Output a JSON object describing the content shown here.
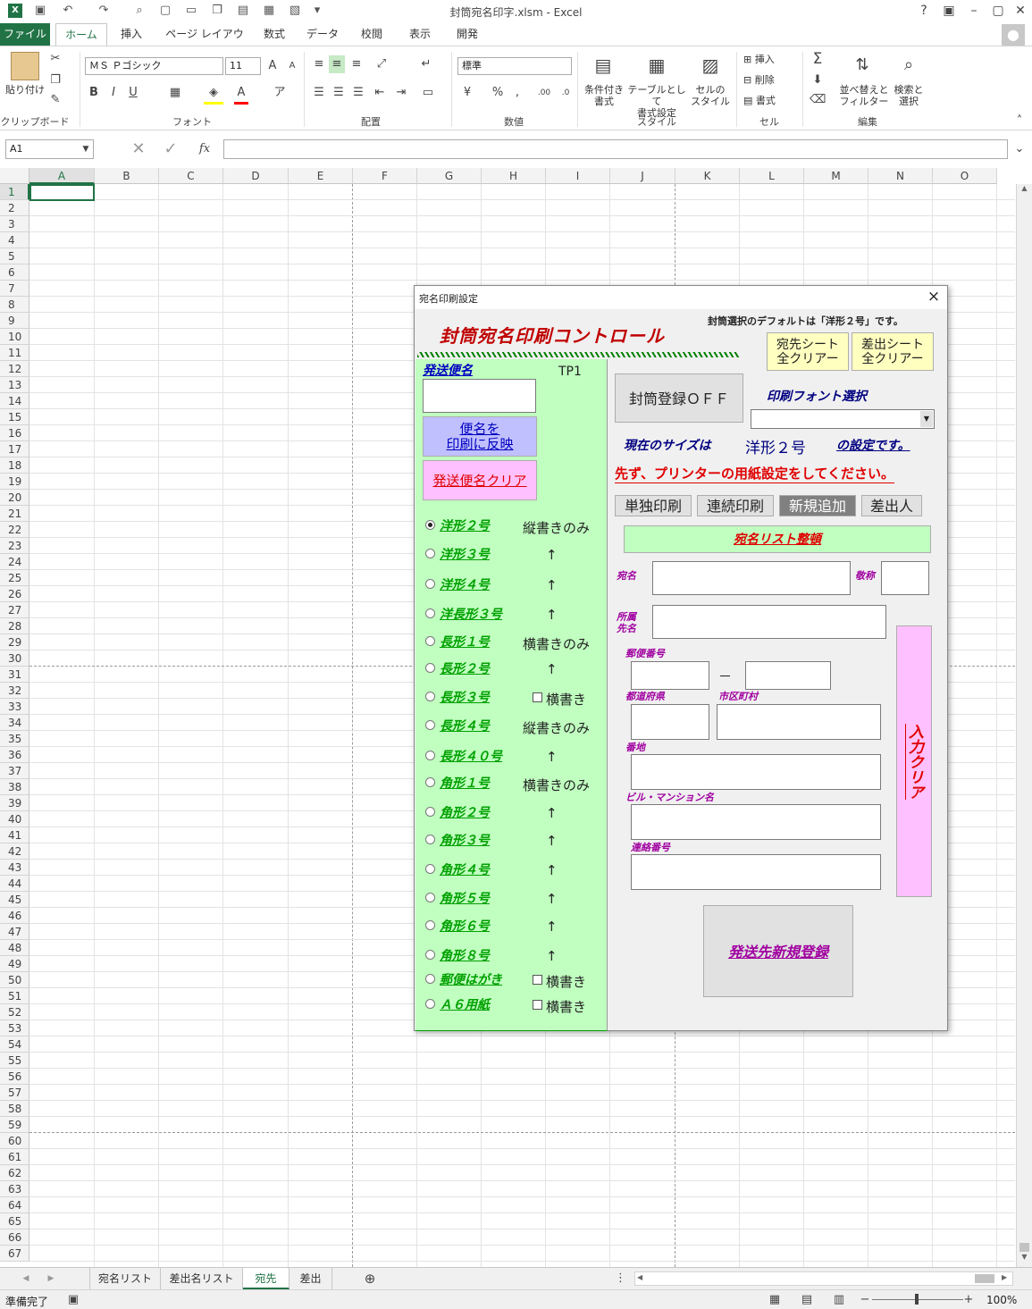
{
  "window": {
    "title": "封筒宛名印字.xlsm - Excel"
  },
  "tabs": [
    "ファイル",
    "ホーム",
    "挿入",
    "ページ レイアウト",
    "数式",
    "データ",
    "校閲",
    "表示",
    "開発"
  ],
  "ribbon": {
    "clipboard": {
      "paste": "貼り付け",
      "label": "クリップボード"
    },
    "font": {
      "name": "ＭＳ Ｐゴシック",
      "size": "11",
      "label": "フォント",
      "bold": "B",
      "italic": "I",
      "underline": "U"
    },
    "alignment": {
      "label": "配置"
    },
    "number": {
      "format": "標準",
      "label": "数値",
      "percent": "%"
    },
    "styles": {
      "conditional": [
        "条件付き",
        "書式"
      ],
      "table": [
        "テーブルとして",
        "書式設定"
      ],
      "cell": [
        "セルの",
        "スタイル"
      ],
      "label": "スタイル"
    },
    "cells": {
      "insert": "挿入",
      "delete": "削除",
      "format": "書式",
      "label": "セル"
    },
    "editing": {
      "sort": [
        "並べ替えと",
        "フィルター"
      ],
      "find": [
        "検索と",
        "選択"
      ],
      "label": "編集"
    }
  },
  "formula_bar": {
    "name_box": "A1",
    "fx": "fx",
    "value": ""
  },
  "grid": {
    "columns": [
      "A",
      "B",
      "C",
      "D",
      "E",
      "F",
      "G",
      "H",
      "I",
      "J",
      "K",
      "L",
      "M",
      "N",
      "O"
    ],
    "rows": [
      "1",
      "2",
      "3",
      "4",
      "5",
      "6",
      "7",
      "8",
      "9",
      "10",
      "11",
      "12",
      "13",
      "14",
      "15",
      "16",
      "17",
      "18",
      "19",
      "20",
      "21",
      "22",
      "23",
      "24",
      "25",
      "26",
      "27",
      "28",
      "29",
      "30",
      "31",
      "32",
      "33",
      "34",
      "35",
      "36",
      "37",
      "38",
      "39",
      "40",
      "41",
      "42",
      "43",
      "44",
      "45",
      "46",
      "47",
      "48",
      "49",
      "50",
      "51",
      "52",
      "53",
      "54",
      "55",
      "56",
      "57",
      "58",
      "59",
      "60",
      "61",
      "62",
      "63",
      "64",
      "65",
      "66",
      "67"
    ]
  },
  "sheet_tabs": [
    "宛名リスト",
    "差出名リスト",
    "宛先",
    "差出"
  ],
  "status": {
    "ready": "準備完了",
    "zoom": "100%"
  },
  "dialog": {
    "title": "宛名印刷設定",
    "close": "×",
    "header": "封筒宛名印刷コントロール",
    "default_note": "封筒選択のデフォルトは「洋形２号」です。",
    "btn_dest_clear": [
      "宛先シート",
      "全クリアー"
    ],
    "btn_sender_clear": [
      "差出シート",
      "全クリアー"
    ],
    "shipping_label": "発送便名",
    "tp": "TP1",
    "btn_reflect": [
      "便名を",
      "印刷に反映"
    ],
    "btn_ship_clear": "発送便名クリア",
    "btn_env_register": "封筒登録ＯＦＦ",
    "font_select_label": "印刷フォント選択",
    "size_label": "現在のサイズは",
    "size_value": "洋形２号",
    "size_suffix": "の設定です。",
    "printer_note": "先ず、プリンターの用紙設定をしてください。",
    "btn_single": "単独印刷",
    "btn_continuous": "連続印刷",
    "btn_new": "新規追加",
    "btn_sender": "差出人",
    "btn_list": "宛名リスト整頓",
    "lbl_name": "宛名",
    "lbl_honor": "敬称",
    "lbl_org": [
      "所属",
      "先名"
    ],
    "lbl_zip": "郵便番号",
    "zip_dash": "－",
    "lbl_pref": "都道府県",
    "lbl_city": "市区町村",
    "lbl_addr": "番地",
    "lbl_bldg": "ビル・マンション名",
    "lbl_tel": "連絡番号",
    "btn_input_clear": "入力クリア",
    "btn_register": "発送先新規登録",
    "envelopes": [
      {
        "label": "洋形２号",
        "note": "縦書きのみ",
        "selected": true
      },
      {
        "label": "洋形３号",
        "note": "↑"
      },
      {
        "label": "洋形４号",
        "note": "↑"
      },
      {
        "label": "洋長形３号",
        "note": "↑"
      },
      {
        "label": "長形１号",
        "note": "横書きのみ"
      },
      {
        "label": "長形２号",
        "note": "↑"
      },
      {
        "label": "長形３号",
        "note": "横書き",
        "check": true
      },
      {
        "label": "長形４号",
        "note": "縦書きのみ"
      },
      {
        "label": "長形４０号",
        "note": "↑"
      },
      {
        "label": "角形１号",
        "note": "横書きのみ"
      },
      {
        "label": "角形２号",
        "note": "↑"
      },
      {
        "label": "角形３号",
        "note": "↑"
      },
      {
        "label": "角形４号",
        "note": "↑"
      },
      {
        "label": "角形５号",
        "note": "↑"
      },
      {
        "label": "角形６号",
        "note": "↑"
      },
      {
        "label": "角形８号",
        "note": "↑"
      },
      {
        "label": "郵便はがき",
        "note": "横書き",
        "check": true
      },
      {
        "label": "Ａ６用紙",
        "note": "横書き",
        "check": true
      }
    ]
  }
}
